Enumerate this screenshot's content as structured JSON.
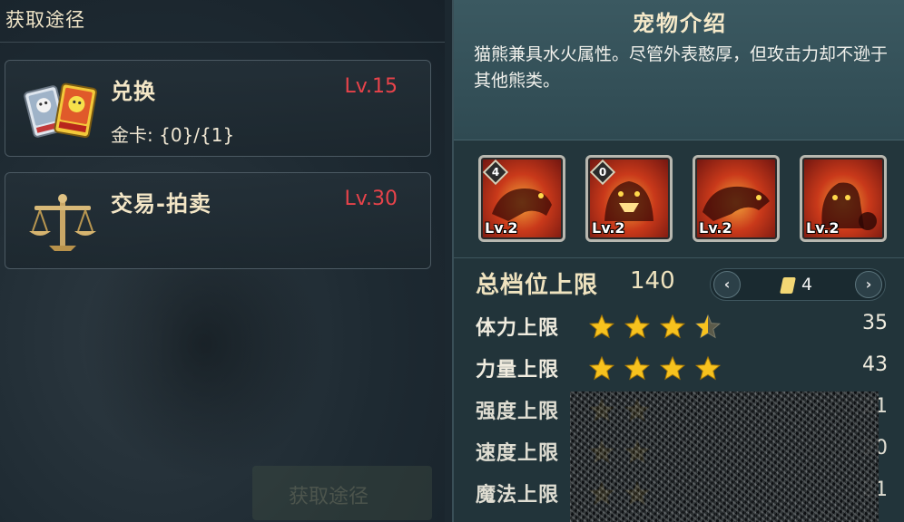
{
  "left": {
    "title": "获取途径",
    "ghost_text": "",
    "sources": [
      {
        "name": "兑换",
        "level": "Lv.15",
        "detail": "金卡: {0}/{1}",
        "icon": "card-exchange-icon"
      },
      {
        "name": "交易-拍卖",
        "level": "Lv.30",
        "detail": "",
        "icon": "balance-scale-icon"
      }
    ],
    "bottom_button": "获取途径"
  },
  "right": {
    "title": "宠物介绍",
    "description": "猫熊兼具水火属性。尽管外表憨厚，但攻击力却不逊于其他熊类。",
    "skills": [
      {
        "badge": "4",
        "level": "Lv.2",
        "icon": "fire-bear-skill-icon"
      },
      {
        "badge": "0",
        "level": "Lv.2",
        "icon": "fire-roar-skill-icon"
      },
      {
        "badge": "",
        "level": "Lv.2",
        "icon": "fire-charge-skill-icon"
      },
      {
        "badge": "",
        "level": "Lv.2",
        "icon": "flame-guard-skill-icon"
      }
    ],
    "cap": {
      "label": "总档位上限",
      "value": "140"
    },
    "pager": {
      "count": "4",
      "prev": "‹",
      "next": "›"
    },
    "stats": [
      {
        "name": "体力上限",
        "stars": 3.5,
        "value": "35"
      },
      {
        "name": "力量上限",
        "stars": 4,
        "value": "43"
      },
      {
        "name": "强度上限",
        "stars": 2,
        "value": "21"
      },
      {
        "name": "速度上限",
        "stars": 2,
        "value": "20"
      },
      {
        "name": "魔法上限",
        "stars": 2,
        "value": "21"
      }
    ],
    "colors": {
      "level_red": "#e8434a",
      "star_gold": "#f7c21e"
    }
  }
}
